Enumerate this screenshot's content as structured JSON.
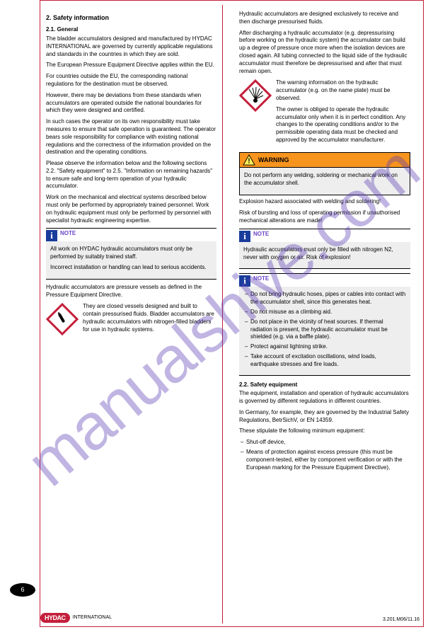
{
  "watermark": "manualshive.com",
  "page_number": "6",
  "footer_left_text": "INTERNATIONAL",
  "footer_right": "3.201.M06/11.16",
  "hydac_logo": "HYDAC",
  "left": {
    "h1": "2. Safety information",
    "h2_21": "2.1. General",
    "p21a": "The bladder accumulators designed and manufactured by HYDAC INTERNATIONAL are governed by currently applicable regulations and standards in the countries in which they are sold.",
    "p21b": "The European Pressure Equipment Directive applies within the EU.",
    "p21c": "For countries outside the EU, the corresponding national regulations for the destination must be observed.",
    "p21d": "However, there may be deviations from these standards when accumulators are operated outside the national boundaries for which they were designed and certified.",
    "p21e": "In such cases the operator on its own responsibility must take measures to ensure that safe operation is guaranteed. The operator bears sole responsibility for compliance with existing national regulations and the correctness of the information provided on the destination and the operating conditions.",
    "p21f": "Please observe the information below and the following sections 2.2. \"Safety equipment\" to 2.5. \"Information on remaining hazards\" to ensure safe and long-term operation of your hydraulic accumulator.",
    "p21g": "Work on the mechanical and electrical systems described below must only be performed by appropriately trained personnel. Work on hydraulic equipment must only be performed by personnel with specialist hydraulic engineering expertise.",
    "note1_label": "NOTE",
    "note1_a": "All work on HYDAC hydraulic accumulators must only be performed by suitably trained staff.",
    "note1_b": "Incorrect installation or handling can lead to serious accidents.",
    "p21h": "Hydraulic accumulators are pressure vessels as defined in the Pressure Equipment Directive.",
    "ghs1_text": "They are closed vessels designed and built to contain pressurised fluids. Bladder accumulators are hydraulic accumulators with nitrogen-filled bladders for use in hydraulic systems."
  },
  "right": {
    "p_top_a": "Hydraulic accumulators are designed exclusively to receive and then discharge pressurised fluids.",
    "p_top_b": "After discharging a hydraulic accumulator (e.g. depressurising before working on the hydraulic system) the accumulator can build up a degree of pressure once more when the isolation devices are closed again. All tubing connected to the liquid side of the hydraulic accumulator must therefore be depressurised and after that must remain open.",
    "ghs2_a": "The warning information on the hydraulic accumulator (e.g. on the name plate) must be observed.",
    "ghs2_b": "The owner is obliged to operate the hydraulic accumulator only when it is in perfect condition. Any changes to the operating conditions and/or to the permissible operating data must be checked and approved by the accumulator manufacturer.",
    "warn_title": "WARNING",
    "warn_a": "Do not perform any welding, soldering or mechanical work on the accumulator shell.",
    "warn_b": "Explosion hazard associated with welding and soldering!",
    "warn_c": "Risk of bursting and loss of operating permission if unauthorised mechanical alterations are made!",
    "note2_label": "NOTE",
    "note2_a": "Hydraulic accumulators must only be filled with nitrogen N2, never with oxygen or air. Risk of explosion!",
    "note3_label": "NOTE",
    "note3_items": [
      "Do not bring hydraulic hoses, pipes or cables into contact with the accumulator shell, since this generates heat.",
      "Do not misuse as a climbing aid.",
      "Do not place in the vicinity of heat sources. If thermal radiation is present, the hydraulic accumulator must be shielded (e.g. via a baffle plate).",
      "Protect against lightning strike.",
      "Take account of excitation oscillations, wind loads, earthquake stresses and fire loads."
    ],
    "h2_22": "2.2. Safety equipment",
    "p22a": "The equipment, installation and operation of hydraulic accumulators is governed by different regulations in different countries.",
    "p22b": "In Germany, for example, they are governed by the Industrial Safety Regulations, BetrSichV, or EN 14359.",
    "p22c": "These stipulate the following minimum equipment:",
    "p22_items": [
      "Shut-off device,",
      "Means of protection against excess pressure (this must be component-tested, either by component verification or with the European marking for the Pressure Equipment Directive),"
    ]
  }
}
